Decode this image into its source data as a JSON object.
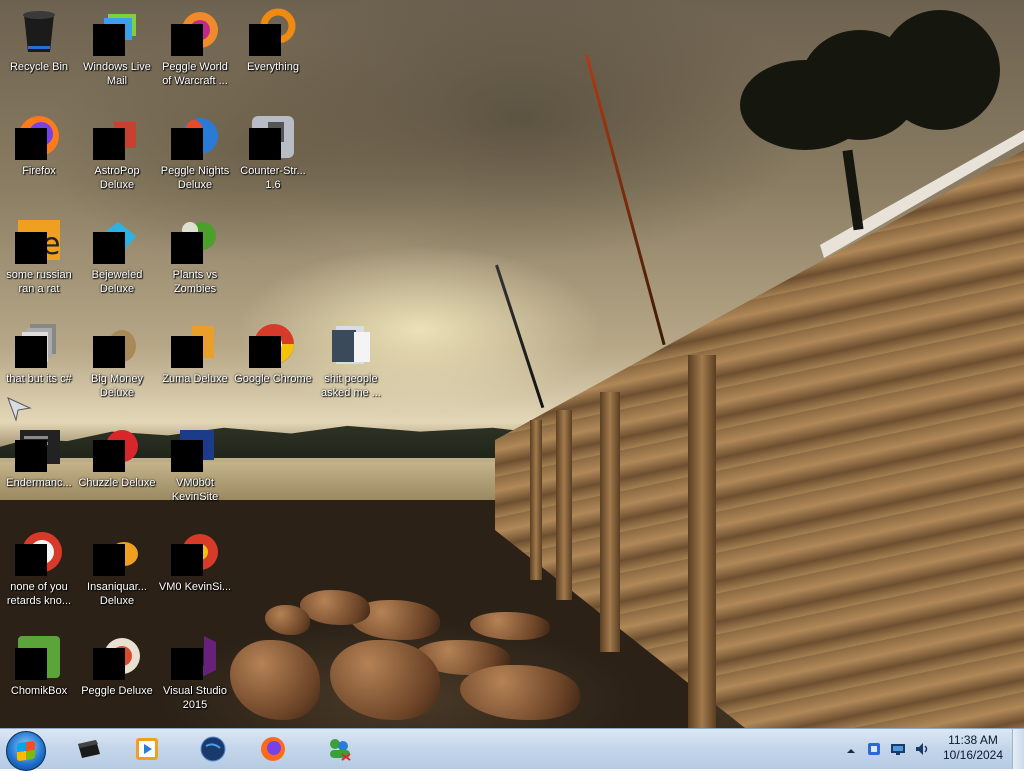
{
  "desktop": {
    "icons": [
      {
        "label": "Recycle Bin",
        "icon": "recycle-bin-icon"
      },
      {
        "label": "Windows Live Mail",
        "icon": "mail-icon"
      },
      {
        "label": "Peggle World of Warcraft ...",
        "icon": "peggle-icon"
      },
      {
        "label": "Everything",
        "icon": "search-icon"
      },
      {
        "label": "Firefox",
        "icon": "firefox-icon"
      },
      {
        "label": "AstroPop Deluxe",
        "icon": "game-icon"
      },
      {
        "label": "Peggle Nights Deluxe",
        "icon": "peggle-icon"
      },
      {
        "label": "Counter-Str... 1.6",
        "icon": "game-icon"
      },
      {
        "label": "some russian ran a rat",
        "icon": "file-icon"
      },
      {
        "label": "Bejeweled Deluxe",
        "icon": "gem-icon"
      },
      {
        "label": "Plants vs Zombies",
        "icon": "game-icon"
      },
      {
        "label": "that but its c#",
        "icon": "file-icon"
      },
      {
        "label": "Big Money Deluxe",
        "icon": "game-icon"
      },
      {
        "label": "Zuma Deluxe",
        "icon": "game-icon"
      },
      {
        "label": "Google Chrome",
        "icon": "chrome-icon"
      },
      {
        "label": "shit people asked me ...",
        "icon": "folder-icon"
      },
      {
        "label": "Endermanc...",
        "icon": "app-icon"
      },
      {
        "label": "Chuzzle Deluxe",
        "icon": "game-icon"
      },
      {
        "label": "VM0b0t KevinSite",
        "icon": "app-icon"
      },
      {
        "label": "none of you retards kno...",
        "icon": "app-icon"
      },
      {
        "label": "Insaniquar... Deluxe",
        "icon": "game-icon"
      },
      {
        "label": "VM0 KevinSi...",
        "icon": "chrome-icon"
      },
      {
        "label": "ChomikBox",
        "icon": "app-icon"
      },
      {
        "label": "Peggle Deluxe",
        "icon": "peggle-icon"
      },
      {
        "label": "Visual Studio 2015",
        "icon": "visual-studio-icon"
      }
    ]
  },
  "taskbar": {
    "pinned": [
      {
        "name": "file-manager-icon"
      },
      {
        "name": "media-player-icon"
      },
      {
        "name": "globe-icon"
      },
      {
        "name": "firefox-icon"
      },
      {
        "name": "messenger-icon"
      }
    ],
    "tray": {
      "time": "11:38 AM",
      "date": "10/16/2024"
    }
  },
  "colors": {
    "taskbar": "#c3d5ea",
    "label_text": "#ffffff"
  }
}
